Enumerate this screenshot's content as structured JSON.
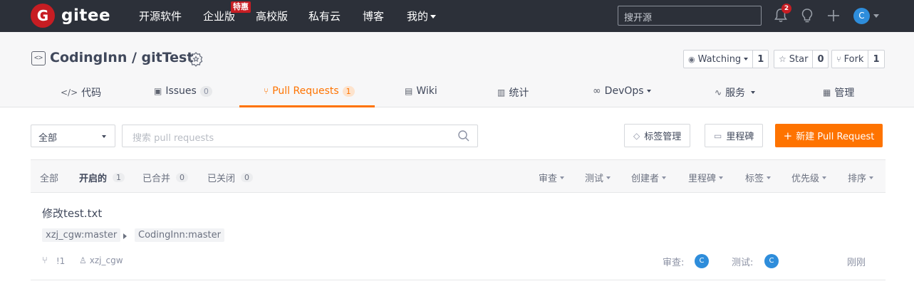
{
  "topnav": {
    "logo_letter": "G",
    "logo_text": "gitee",
    "links": [
      "开源软件",
      "企业版",
      "高校版",
      "私有云",
      "博客",
      "我的"
    ],
    "special_badge": "特惠",
    "search_placeholder": "搜开源",
    "notification_count": "2",
    "avatar_letter": "C"
  },
  "repo": {
    "title": "CodingInn / gitTest",
    "watch_label": "Watching",
    "watch_count": "1",
    "star_label": "Star",
    "star_count": "0",
    "fork_label": "Fork",
    "fork_count": "1"
  },
  "tabs": [
    {
      "label": "代码",
      "icon": "code-icon"
    },
    {
      "label": "Issues",
      "icon": "issues-icon",
      "count": "0"
    },
    {
      "label": "Pull Requests",
      "icon": "pull-request-icon",
      "count": "1"
    },
    {
      "label": "Wiki",
      "icon": "wiki-icon"
    },
    {
      "label": "统计",
      "icon": "stats-icon"
    },
    {
      "label": "DevOps",
      "icon": "devops-icon"
    },
    {
      "label": "服务",
      "icon": "service-icon"
    },
    {
      "label": "管理",
      "icon": "manage-icon"
    }
  ],
  "toolbar": {
    "scope_selected": "全部",
    "search_placeholder": "搜索 pull requests",
    "labels_button": "标签管理",
    "milestones_button": "里程碑",
    "new_pr_button": "新建 Pull Request"
  },
  "list": {
    "states": [
      {
        "label": "全部"
      },
      {
        "label": "开启的",
        "count": "1"
      },
      {
        "label": "已合并",
        "count": "0"
      },
      {
        "label": "已关闭",
        "count": "0"
      }
    ],
    "filters": [
      "审查",
      "测试",
      "创建者",
      "里程碑",
      "标签",
      "优先级",
      "排序"
    ]
  },
  "pull_requests": [
    {
      "title": "修改test.txt",
      "source_branch": "xzj_cgw:master",
      "target_branch": "CodingInn:master",
      "number": "!1",
      "author": "xzj_cgw",
      "reviewer_label": "审查:",
      "reviewer_avatar": "C",
      "tester_label": "测试:",
      "tester_avatar": "C",
      "time": "刚刚"
    }
  ]
}
